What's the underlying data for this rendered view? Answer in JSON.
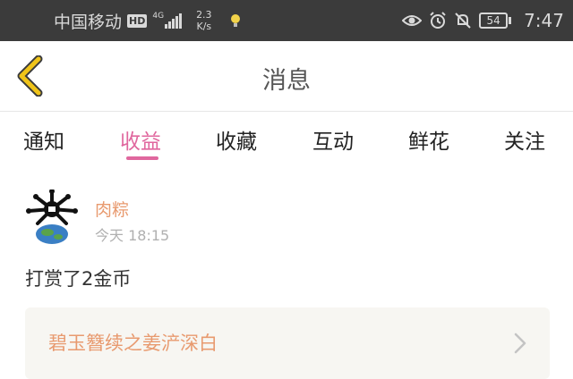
{
  "status_bar": {
    "carrier": "中国移动",
    "hd": "HD",
    "network": "4G",
    "speed_value": "2.3",
    "speed_unit": "K/s",
    "battery": "54",
    "time": "7:47"
  },
  "header": {
    "title": "消息",
    "back_icon": "chevron-left-icon",
    "accent_color": "#f0c419"
  },
  "tabs": [
    {
      "label": "通知",
      "active": false
    },
    {
      "label": "收益",
      "active": true
    },
    {
      "label": "收藏",
      "active": false
    },
    {
      "label": "互动",
      "active": false
    },
    {
      "label": "鲜花",
      "active": false
    },
    {
      "label": "关注",
      "active": false
    }
  ],
  "colors": {
    "tab_active": "#e0679e",
    "username": "#e89a6f",
    "status_bar_bg": "#3b3b3b"
  },
  "message": {
    "username": "肉粽",
    "time": "今天 18:15",
    "content": "打赏了2金币",
    "reference_title": "碧玉簪续之姜浐深白"
  }
}
